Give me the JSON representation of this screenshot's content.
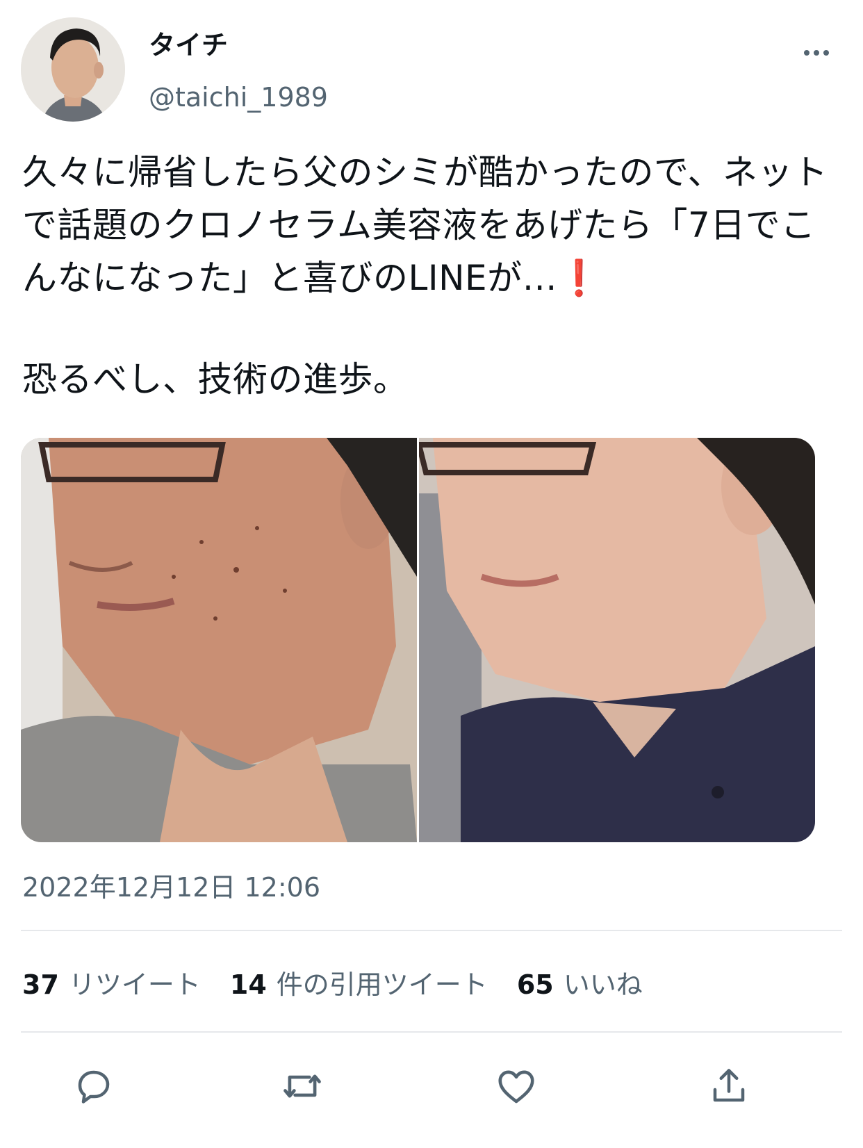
{
  "user": {
    "display_name": "タイチ",
    "handle": "@taichi_1989"
  },
  "tweet": {
    "paragraph1": "久々に帰省したら父のシミが酷かったので、ネットで話題のクロノセラム美容液をあげたら「7日でこんなになった」と喜びのLINEが…",
    "alert_glyph": "❗",
    "paragraph2": "恐るべし、技術の進歩。",
    "timestamp": "2022年12月12日 12:06"
  },
  "stats": [
    {
      "count": "37",
      "label": "リツイート"
    },
    {
      "count": "14",
      "label": "件の引用ツイート"
    },
    {
      "count": "65",
      "label": "いいね"
    }
  ],
  "actions": {
    "reply_icon": "reply-icon",
    "retweet_icon": "retweet-icon",
    "like_icon": "heart-icon",
    "share_icon": "share-icon"
  },
  "colors": {
    "text": "#0f1419",
    "secondary": "#536471",
    "divider": "#e6e8eb",
    "alert": "#d9232e"
  }
}
